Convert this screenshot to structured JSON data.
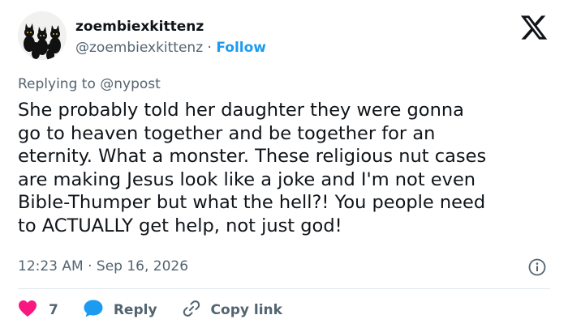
{
  "author": {
    "display_name": "zoembiexkittenz",
    "handle": "@zoembiexkittenz",
    "separator": "·",
    "follow_label": "Follow"
  },
  "reply_context": "Replying to @nypost",
  "tweet_text": "She probably told her daughter they were gonna\ngo to heaven together and be together for an\neternity. What a monster. These religious nut cases\nare making Jesus look like a joke and I'm not even\nBible-Thumper but what the hell?! You people need\nto ACTUALLY get help, not just god!",
  "timestamp": "12:23 AM · Sep 16, 2026",
  "actions": {
    "like_count": "7",
    "reply_label": "Reply",
    "copy_link_label": "Copy link"
  },
  "icons": {
    "logo": "x-logo-icon",
    "info": "info-icon",
    "like": "heart-icon",
    "reply": "speech-bubble-icon",
    "copy": "link-icon"
  },
  "colors": {
    "accent": "#1d9bf0",
    "like": "#f91880",
    "text": "#0f1419",
    "muted": "#536471"
  }
}
